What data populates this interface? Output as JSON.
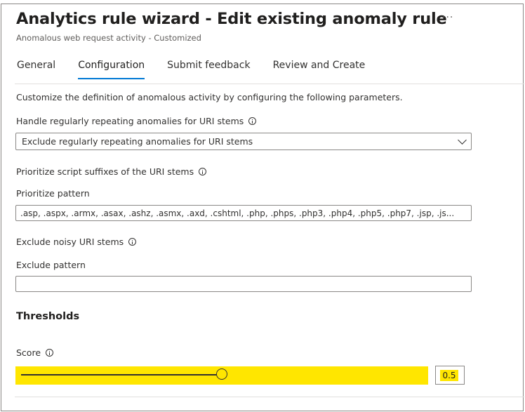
{
  "header": {
    "title": "Analytics rule wizard - Edit existing anomaly rule",
    "subtitle": "Anomalous web request activity - Customized",
    "more_label": "···"
  },
  "tabs": [
    {
      "label": "General",
      "active": false
    },
    {
      "label": "Configuration",
      "active": true
    },
    {
      "label": "Submit feedback",
      "active": false
    },
    {
      "label": "Review and Create",
      "active": false
    }
  ],
  "config": {
    "description": "Customize the definition of anomalous activity by configuring the following parameters.",
    "repeating": {
      "label": "Handle regularly repeating anomalies for URI stems",
      "selected": "Exclude regularly repeating anomalies for URI stems"
    },
    "prioritize": {
      "section_label": "Prioritize script suffixes of the URI stems",
      "pattern_label": "Prioritize pattern",
      "pattern_value": ".asp, .aspx, .armx, .asax, .ashz, .asmx, .axd, .cshtml, .php, .phps, .php3, .php4, .php5, .php7, .jsp, .js..."
    },
    "exclude": {
      "section_label": "Exclude noisy URI stems",
      "pattern_label": "Exclude pattern",
      "pattern_value": ""
    },
    "thresholds": {
      "title": "Thresholds",
      "score_label": "Score",
      "score_value": "0.5",
      "score_fraction": 0.5
    }
  },
  "colors": {
    "accent": "#0078d4",
    "highlight": "#ffe600"
  }
}
